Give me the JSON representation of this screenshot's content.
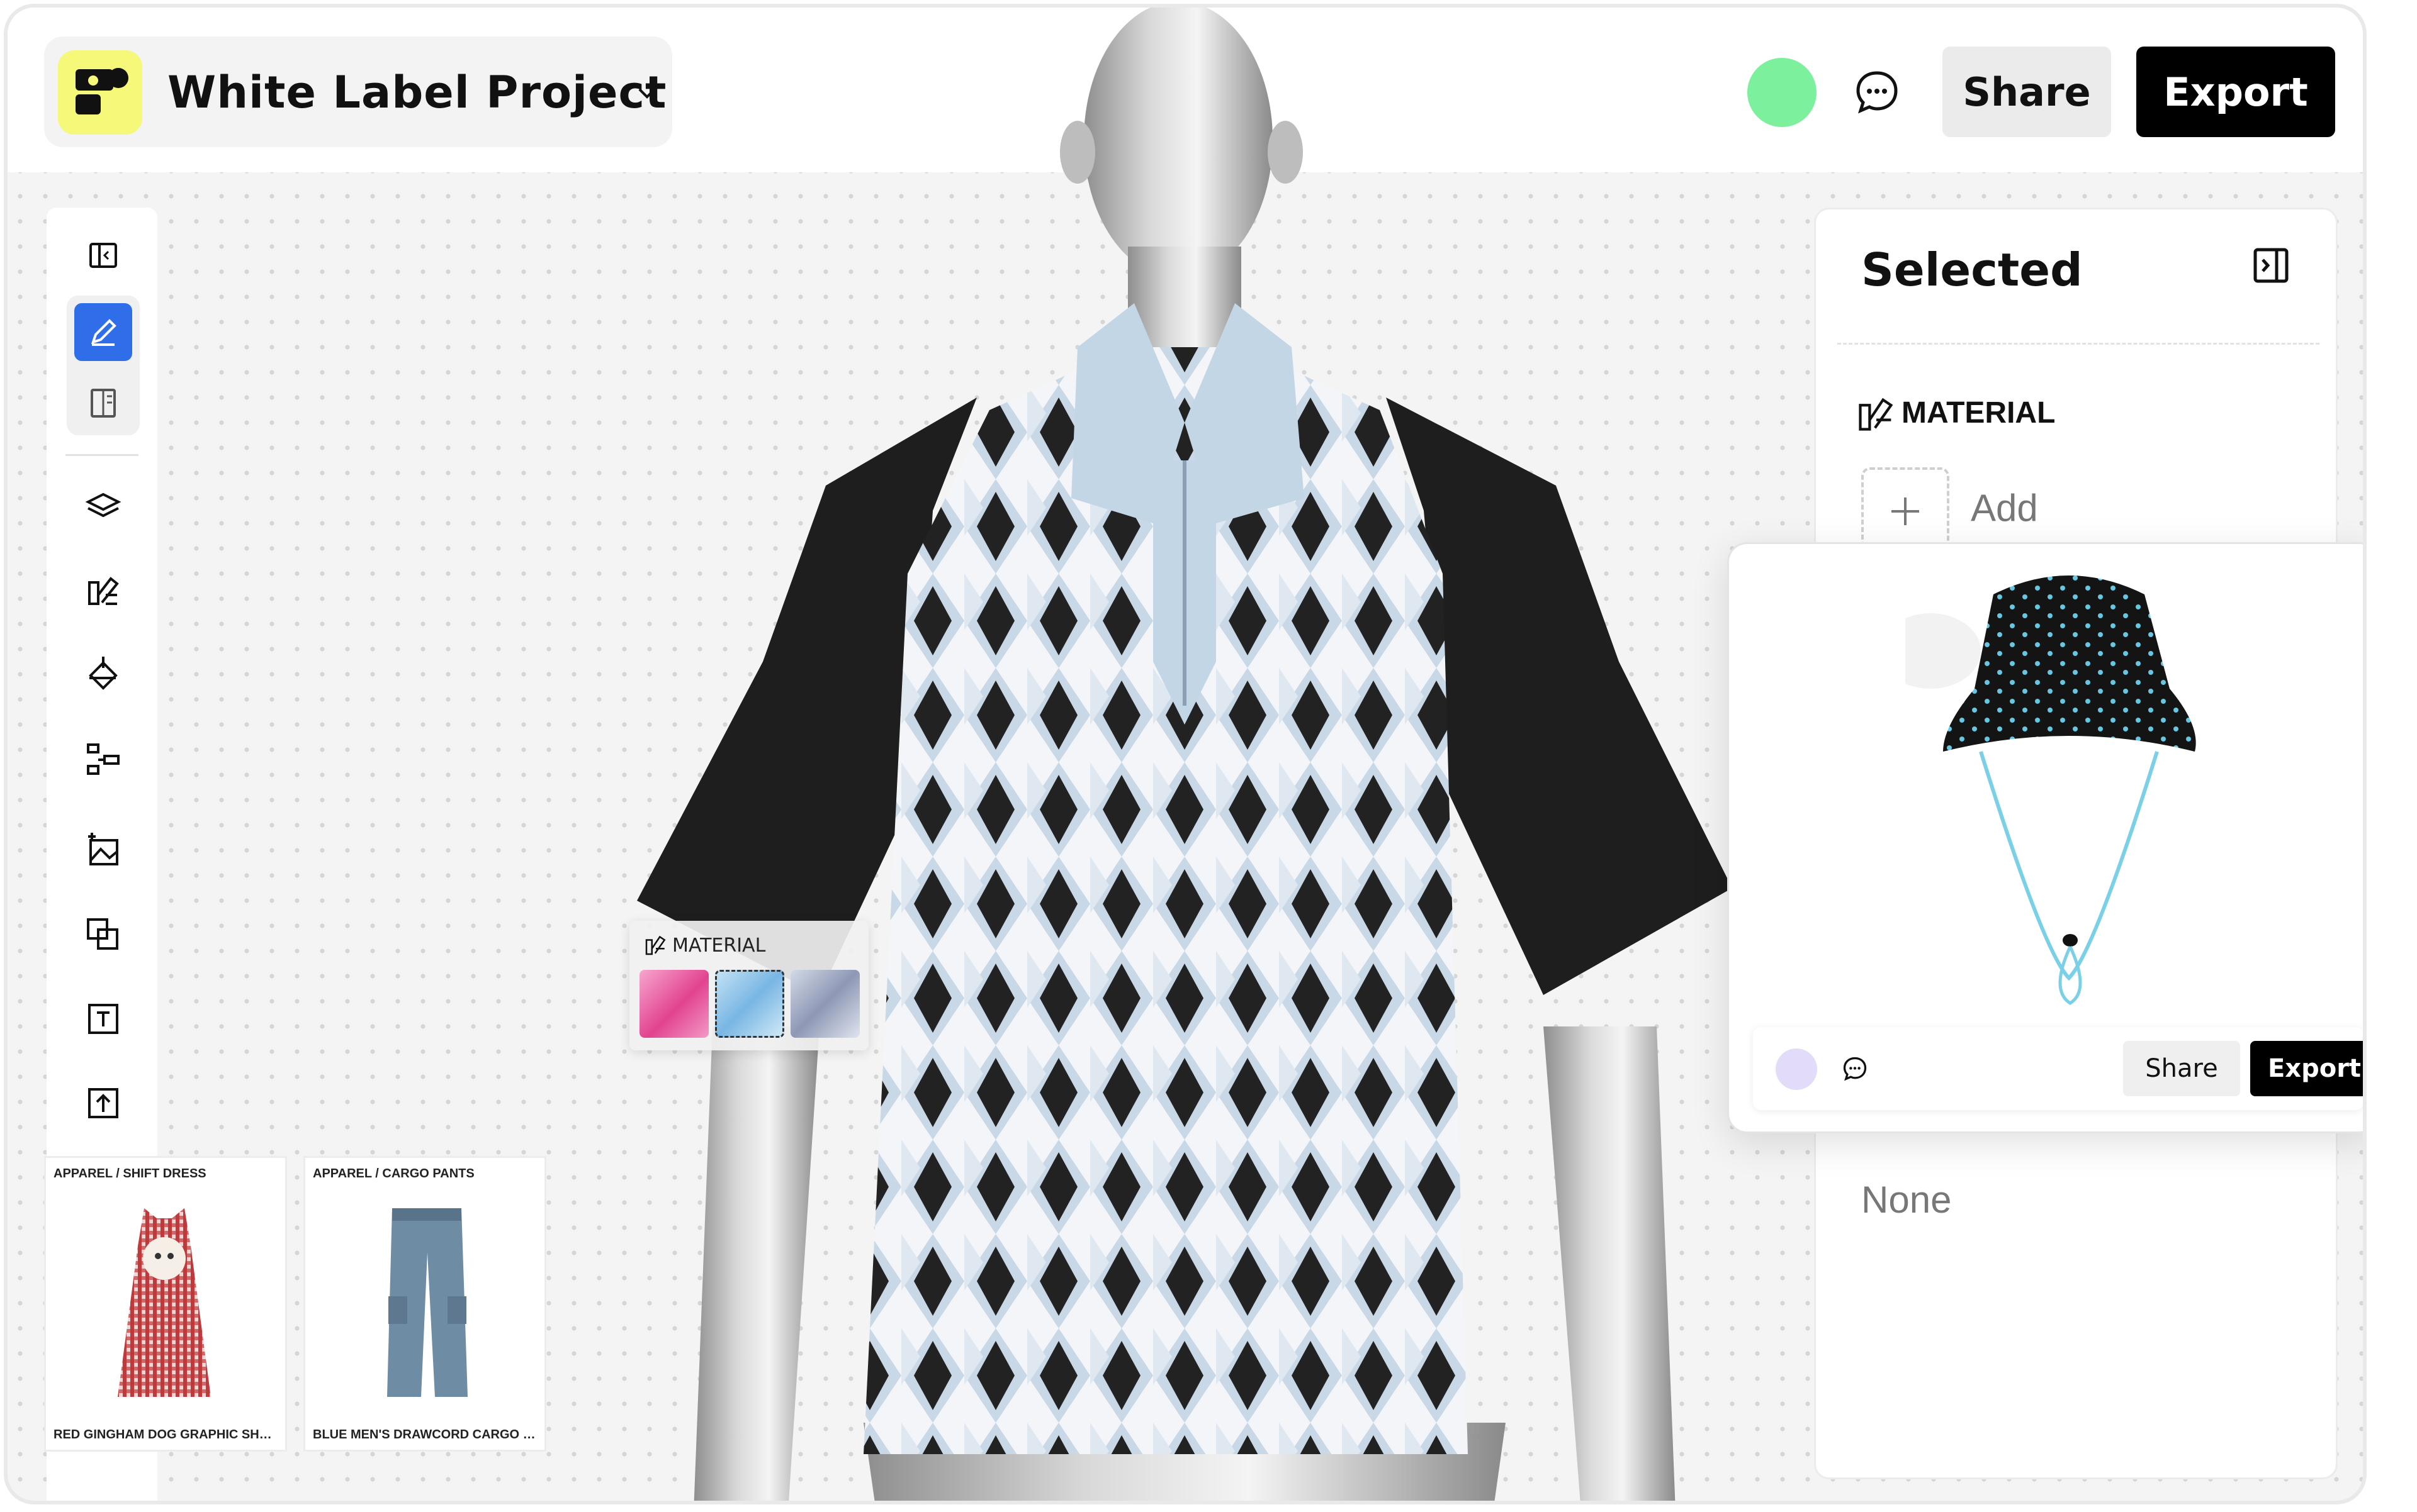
{
  "app": {
    "project_title": "White Label Project",
    "accent": "#2f6ee8",
    "logo_color": "#f6f87a",
    "presence_color": "#7cf09c"
  },
  "header": {
    "share_label": "Share",
    "export_label": "Export"
  },
  "toolbar": {
    "tools": [
      "collapse-sidebar-icon",
      "pen-icon",
      "pattern-book-icon",
      "layers-icon",
      "material-library-icon",
      "paint-bucket-icon",
      "align-icon",
      "add-image-icon",
      "overlap-icon",
      "text-frame-icon",
      "upload-icon"
    ],
    "active_tool": "pen-icon"
  },
  "catalog": [
    {
      "category": "APPAREL / SHIFT DRESS",
      "name": "RED GINGHAM DOG GRAPHIC SHORT..."
    },
    {
      "category": "APPAREL / CARGO PANTS",
      "name": "BLUE MEN'S DRAWCORD CARGO PANTS"
    }
  ],
  "material_popover": {
    "label": "MATERIAL",
    "swatches": [
      "pink-silk",
      "blue-chiffon",
      "grey-satin"
    ]
  },
  "selected_panel": {
    "title": "Selected",
    "material_heading": "MATERIAL",
    "add_label": "Add",
    "none_label": "None"
  },
  "floating_preview": {
    "share_label": "Share",
    "export_label": "Export",
    "avatar_color": "#e2dcfa"
  }
}
